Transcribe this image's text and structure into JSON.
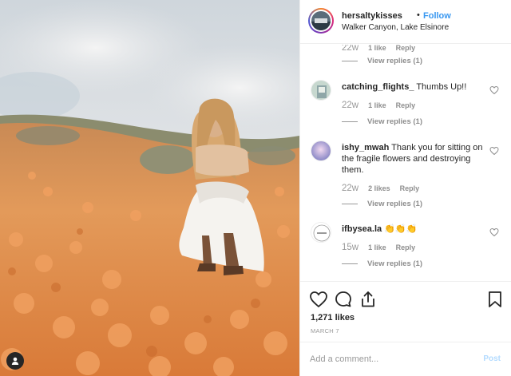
{
  "header": {
    "username": "hersaltykisses",
    "separator": "•",
    "follow_label": "Follow",
    "location": "Walker Canyon, Lake Elsinore"
  },
  "comments": [
    {
      "time": "22w",
      "likes": "1 like",
      "reply": "Reply",
      "view_replies": "View replies (1)"
    },
    {
      "username": "catching_flights_",
      "text": "Thumbs Up!!",
      "time": "22w",
      "likes": "1 like",
      "reply": "Reply",
      "view_replies": "View replies (1)"
    },
    {
      "username": "ishy_mwah",
      "text": "Thank you for sitting on the fragile flowers and destroying them.",
      "time": "22w",
      "likes": "2 likes",
      "reply": "Reply",
      "view_replies": "View replies (1)"
    },
    {
      "username": "ifbysea.la",
      "text": "👏👏👏",
      "time": "15w",
      "likes": "1 like",
      "reply": "Reply",
      "view_replies": "View replies (1)"
    }
  ],
  "icons": {
    "like": "heart-icon",
    "comment": "comment-bubble-icon",
    "share": "share-icon",
    "save": "bookmark-icon",
    "user_tag": "user-tag-icon"
  },
  "likes_count": "1,271 likes",
  "post_date": "MARCH 7",
  "add_comment": {
    "placeholder": "Add a comment...",
    "post_label": "Post"
  },
  "colors": {
    "link_blue": "#3897f0",
    "post_disabled": "#b3dbff",
    "muted": "#8e8e8e",
    "border": "#efefef"
  }
}
